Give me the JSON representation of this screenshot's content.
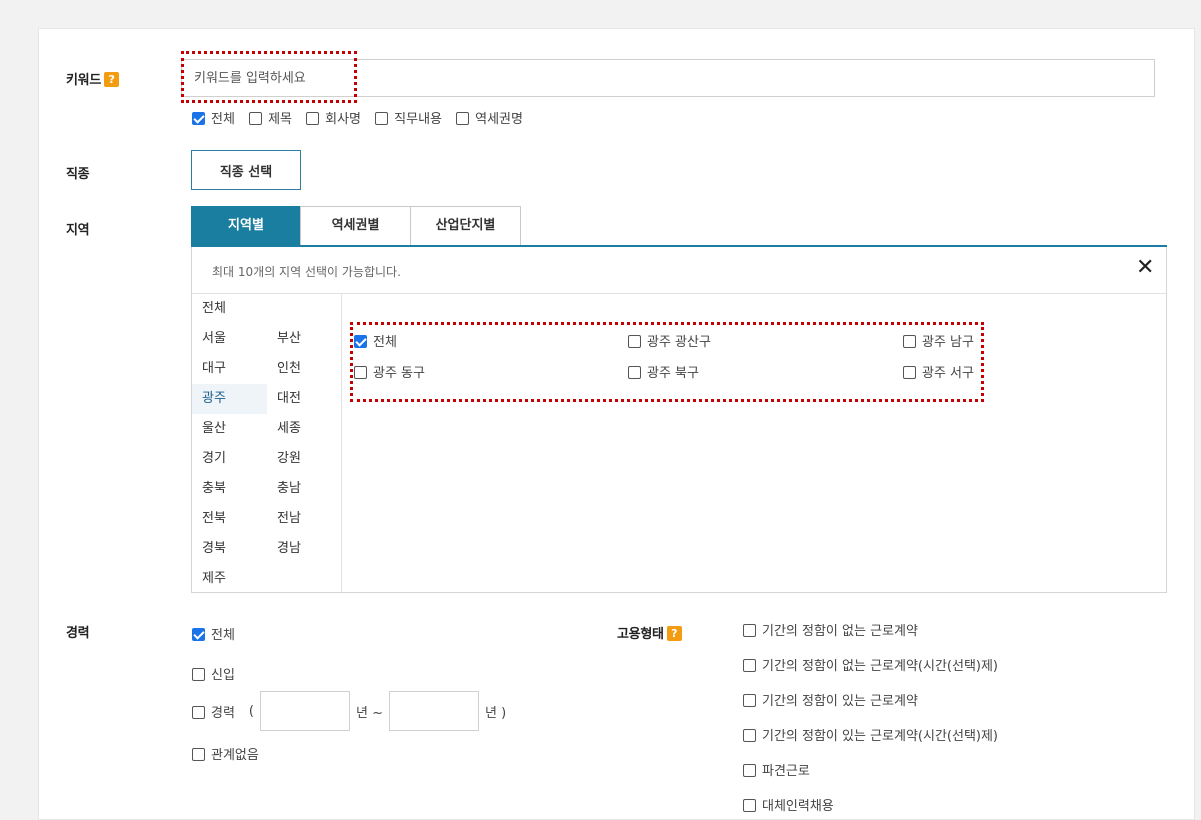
{
  "keyword": {
    "label": "키워드",
    "help": "?",
    "placeholder": "키워드를 입력하세요",
    "scopes": [
      {
        "label": "전체",
        "checked": true
      },
      {
        "label": "제목",
        "checked": false
      },
      {
        "label": "회사명",
        "checked": false
      },
      {
        "label": "직무내용",
        "checked": false
      },
      {
        "label": "역세권명",
        "checked": false
      }
    ]
  },
  "job": {
    "label": "직종",
    "button": "직종 선택"
  },
  "region": {
    "label": "지역",
    "tabs": [
      "지역별",
      "역세권별",
      "산업단지별"
    ],
    "notice": "최대 10개의 지역 선택이 가능합니다.",
    "close": "✕",
    "cities": [
      "전체",
      "서울",
      "부산",
      "대구",
      "인천",
      "광주",
      "대전",
      "울산",
      "세종",
      "경기",
      "강원",
      "충북",
      "충남",
      "전북",
      "전남",
      "경북",
      "경남",
      "제주"
    ],
    "selected_city": "광주",
    "districts": [
      {
        "label": "전체",
        "checked": true
      },
      {
        "label": "광주 광산구",
        "checked": false
      },
      {
        "label": "광주 남구",
        "checked": false
      },
      {
        "label": "광주 동구",
        "checked": false
      },
      {
        "label": "광주 북구",
        "checked": false
      },
      {
        "label": "광주 서구",
        "checked": false
      }
    ]
  },
  "career": {
    "label": "경력",
    "all": "전체",
    "newbie": "신입",
    "experienced": "경력",
    "paren_open": "(",
    "year_to": "년 ~",
    "year_end": "년 )",
    "none": "관계없음"
  },
  "employment": {
    "label": "고용형태",
    "help": "?",
    "options": [
      "기간의 정함이 없는 근로계약",
      "기간의 정함이 없는 근로계약(시간(선택)제)",
      "기간의 정함이 있는 근로계약",
      "기간의 정함이 있는 근로계약(시간(선택)제)",
      "파견근로",
      "대체인력채용"
    ]
  }
}
